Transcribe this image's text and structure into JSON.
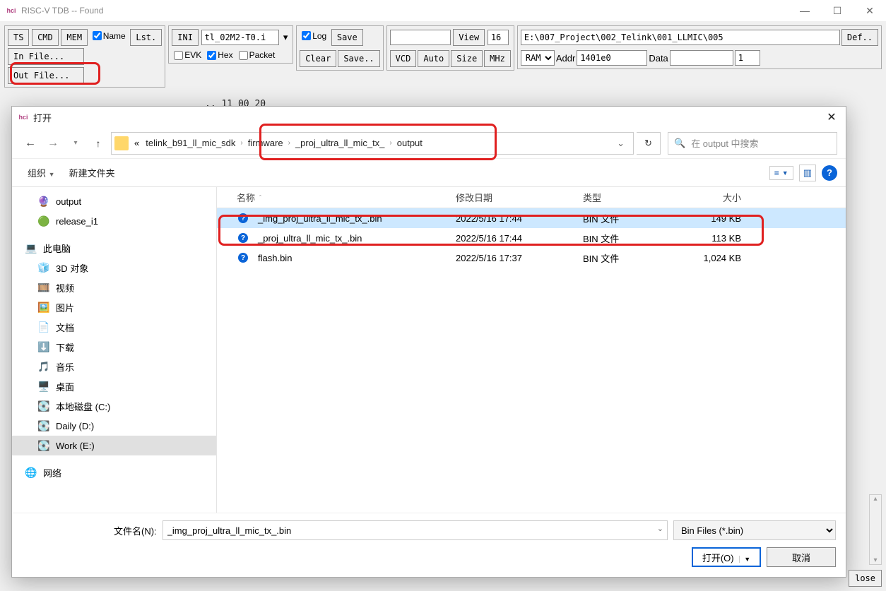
{
  "window": {
    "title": "RISC-V TDB -- Found",
    "icon_label": "hci"
  },
  "toolbar": {
    "g1": {
      "ts": "TS",
      "cmd": "CMD",
      "mem": "MEM",
      "name_chk": "Name",
      "lst": "Lst.",
      "infile": "In File...",
      "outfile": "Out File..."
    },
    "g2": {
      "ini": "INI",
      "ini_val": "tl_02M2-T0.i",
      "evk": "EVK",
      "hex": "Hex",
      "packet": "Packet"
    },
    "g3": {
      "log": "Log",
      "save": "Save",
      "clear": "Clear",
      "save2": "Save.."
    },
    "g4": {
      "view": "View",
      "view_val": "16",
      "vcd": "VCD",
      "auto": "Auto",
      "size": "Size",
      "mhz": "MHz"
    },
    "g5": {
      "path": "E:\\007_Project\\002_Telink\\001_LLMIC\\005",
      "ram": "RAM",
      "addr_lbl": "Addr",
      "addr_val": "1401e0",
      "data_lbl": "Data",
      "data_val": "",
      "one": "1",
      "def": "Def.."
    }
  },
  "hexline": ".. 11 00 20",
  "dialog": {
    "title": "打开",
    "breadcrumb": {
      "ellip": "«",
      "segs": [
        "telink_b91_ll_mic_sdk",
        "firmware",
        "_proj_ultra_ll_mic_tx_",
        "output"
      ]
    },
    "search_placeholder": "在 output 中搜索",
    "organize": "组织",
    "newfolder": "新建文件夹",
    "nav": [
      {
        "icon": "🔮",
        "label": "output",
        "lvl": "l2"
      },
      {
        "icon": "🟢",
        "label": "release_i1",
        "lvl": "l2"
      },
      {
        "spacer": true
      },
      {
        "icon": "💻",
        "label": "此电脑",
        "lvl": "l1"
      },
      {
        "icon": "🧊",
        "label": "3D 对象",
        "lvl": "l2"
      },
      {
        "icon": "🎞️",
        "label": "视频",
        "lvl": "l2"
      },
      {
        "icon": "🖼️",
        "label": "图片",
        "lvl": "l2"
      },
      {
        "icon": "📄",
        "label": "文档",
        "lvl": "l2"
      },
      {
        "icon": "⬇️",
        "label": "下载",
        "lvl": "l2"
      },
      {
        "icon": "🎵",
        "label": "音乐",
        "lvl": "l2"
      },
      {
        "icon": "🖥️",
        "label": "桌面",
        "lvl": "l2"
      },
      {
        "icon": "💽",
        "label": "本地磁盘 (C:)",
        "lvl": "l2"
      },
      {
        "icon": "💽",
        "label": "Daily (D:)",
        "lvl": "l2"
      },
      {
        "icon": "💽",
        "label": "Work (E:)",
        "lvl": "l2",
        "sel": true
      },
      {
        "spacer": true
      },
      {
        "icon": "🌐",
        "label": "网络",
        "lvl": "l1"
      }
    ],
    "columns": {
      "name": "名称",
      "date": "修改日期",
      "type": "类型",
      "size": "大小"
    },
    "files": [
      {
        "name": "_img_proj_ultra_ll_mic_tx_.bin",
        "date": "2022/5/16 17:44",
        "type": "BIN 文件",
        "size": "149 KB",
        "sel": true
      },
      {
        "name": "_proj_ultra_ll_mic_tx_.bin",
        "date": "2022/5/16 17:44",
        "type": "BIN 文件",
        "size": "113 KB"
      },
      {
        "name": "flash.bin",
        "date": "2022/5/16 17:37",
        "type": "BIN 文件",
        "size": "1,024 KB"
      }
    ],
    "filename_label": "文件名(N):",
    "filename_value": "_img_proj_ultra_ll_mic_tx_.bin",
    "filetype": "Bin Files (*.bin)",
    "open_btn": "打开(O)",
    "cancel_btn": "取消"
  },
  "bottom_close": "lose"
}
